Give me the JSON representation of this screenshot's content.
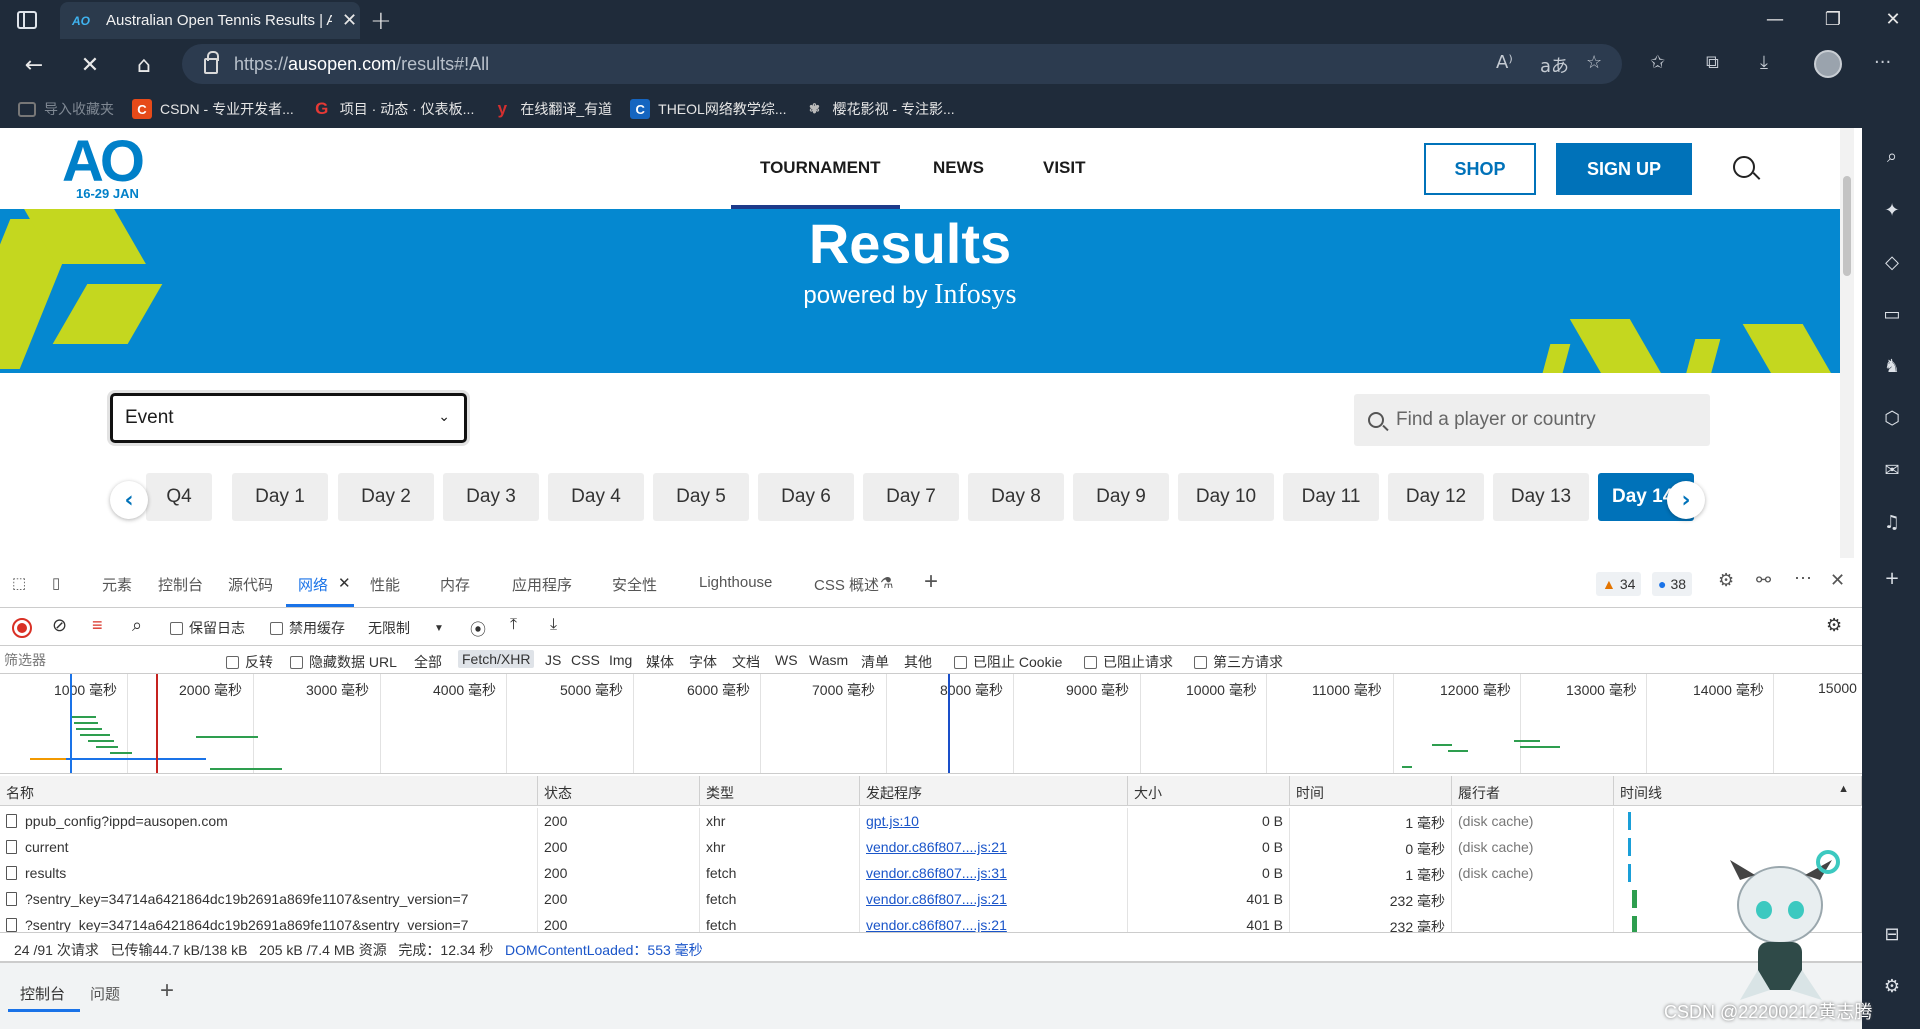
{
  "browser": {
    "tab_title": "Australian Open Tennis Results | A",
    "tab_favicon": "AO",
    "url_prefix": "https://",
    "url_host": "ausopen.com",
    "url_path": "/results#!All",
    "favorites": [
      {
        "label": "导入收藏夹",
        "icon": "folder-icon",
        "color": "#3a3a3a"
      },
      {
        "label": "CSDN - 专业开发者...",
        "icon": "C",
        "color": "#e64a19"
      },
      {
        "label": "项目 · 动态 · 仪表板...",
        "icon": "G",
        "color": "#e53935"
      },
      {
        "label": "在线翻译_有道",
        "icon": "y",
        "color": "#d32f2f"
      },
      {
        "label": "THEOL网络教学综...",
        "icon": "C",
        "color": "#1565c0"
      },
      {
        "label": "樱花影视 - 专注影...",
        "icon": "flower-icon",
        "color": "#555555"
      }
    ]
  },
  "site": {
    "logo": "AO",
    "dates": "16-29 JAN",
    "nav": [
      "TOURNAMENT",
      "NEWS",
      "VISIT"
    ],
    "shop": "SHOP",
    "signup": "SIGN UP",
    "hero_title": "Results",
    "hero_sub_prefix": "powered by ",
    "hero_sub_brand": "Infosys",
    "event_select": "Event",
    "player_search_placeholder": "Find a player or country",
    "days": [
      "Q4",
      "Day 1",
      "Day 2",
      "Day 3",
      "Day 4",
      "Day 5",
      "Day 6",
      "Day 7",
      "Day 8",
      "Day 9",
      "Day 10",
      "Day 11",
      "Day 12",
      "Day 13",
      "Day 14"
    ],
    "active_day": "Day 14",
    "accent_color": "#0072b9",
    "hero_color": "#0588d0",
    "hero_accent_color": "#c4d71f"
  },
  "devtools": {
    "tabs": [
      "元素",
      "控制台",
      "源代码",
      "网络",
      "性能",
      "内存",
      "应用程序",
      "安全性",
      "Lighthouse",
      "CSS 概述"
    ],
    "active_tab": "网络",
    "warnings": "34",
    "messages": "38",
    "toolbar": {
      "preserve_log": "保留日志",
      "disable_cache": "禁用缓存",
      "throttling": "无限制"
    },
    "filter": {
      "placeholder": "筛选器",
      "invert": "反转",
      "hide_data_url": "隐藏数据 URL",
      "types": [
        "全部",
        "Fetch/XHR",
        "JS",
        "CSS",
        "Img",
        "媒体",
        "字体",
        "文档",
        "WS",
        "Wasm",
        "清单",
        "其他"
      ],
      "selected_type": "Fetch/XHR",
      "blocked_cookies": "已阻止 Cookie",
      "blocked_requests": "已阻止请求",
      "third_party": "第三方请求"
    },
    "overview_ticks": [
      "1000 毫秒",
      "2000 毫秒",
      "3000 毫秒",
      "4000 毫秒",
      "5000 毫秒",
      "6000 毫秒",
      "7000 毫秒",
      "8000 毫秒",
      "9000 毫秒",
      "10000 毫秒",
      "11000 毫秒",
      "12000 毫秒",
      "13000 毫秒",
      "14000 毫秒",
      "15000"
    ],
    "columns": [
      "名称",
      "状态",
      "类型",
      "发起程序",
      "大小",
      "时间",
      "履行者",
      "时间线"
    ],
    "rows": [
      {
        "name": "ppub_config?ippd=ausopen.com",
        "status": "200",
        "type": "xhr",
        "initiator": "gpt.js:10",
        "size": "0 B",
        "time": "1 毫秒",
        "fulfilled": "(disk cache)"
      },
      {
        "name": "current",
        "status": "200",
        "type": "xhr",
        "initiator": "vendor.c86f807....js:21",
        "size": "0 B",
        "time": "0 毫秒",
        "fulfilled": "(disk cache)"
      },
      {
        "name": "results",
        "status": "200",
        "type": "fetch",
        "initiator": "vendor.c86f807....js:31",
        "size": "0 B",
        "time": "1 毫秒",
        "fulfilled": "(disk cache)"
      },
      {
        "name": "?sentry_key=34714a6421864dc19b2691a869fe1107&sentry_version=7",
        "status": "200",
        "type": "fetch",
        "initiator": "vendor.c86f807....js:21",
        "size": "401 B",
        "time": "232 毫秒",
        "fulfilled": ""
      },
      {
        "name": "?sentry_key=34714a6421864dc19b2691a869fe1107&sentry_version=7",
        "status": "200",
        "type": "fetch",
        "initiator": "vendor.c86f807....js:21",
        "size": "401 B",
        "time": "232 毫秒",
        "fulfilled": ""
      }
    ],
    "status_line": {
      "requests": "24 /91 次请求",
      "transferred": "已传输44.7 kB/138 kB",
      "resources": "205 kB /7.4 MB 资源",
      "finish": "完成：12.34 秒",
      "dcl": "DOMContentLoaded：553 毫秒"
    },
    "drawer_tabs": [
      "控制台",
      "问题"
    ]
  },
  "watermark": "CSDN @22200212黄志腾"
}
